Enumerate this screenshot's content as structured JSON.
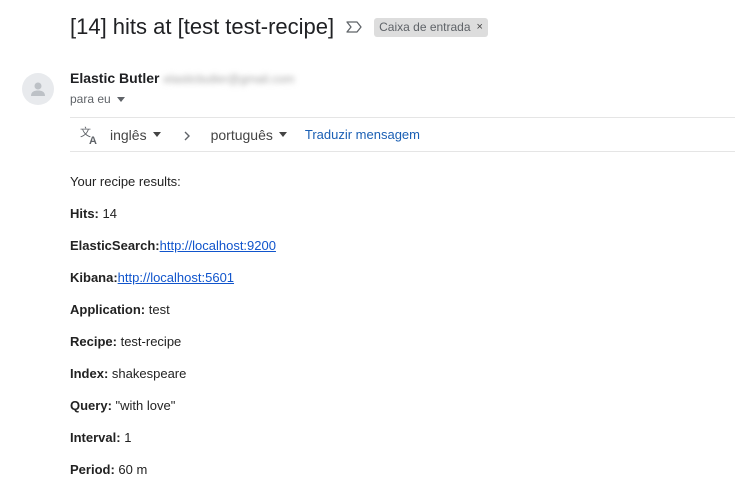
{
  "email": {
    "subject": "[14] hits at [test test-recipe]",
    "label": "Caixa de entrada",
    "label_close": "×",
    "sender_name": "Elastic Butler",
    "sender_email": "elasticbutler@gmail.com",
    "to": "para eu"
  },
  "translate": {
    "source_lang": "inglês",
    "target_lang": "português",
    "action": "Traduzir mensagem"
  },
  "body": {
    "intro": "Your recipe results:",
    "hits_label": "Hits:",
    "hits_value": "14",
    "es_label": "ElasticSearch:",
    "es_url": "http://localhost:9200",
    "kibana_label": "Kibana:",
    "kibana_url": "http://localhost:5601",
    "application_label": "Application:",
    "application_value": "test",
    "recipe_label": "Recipe:",
    "recipe_value": "test-recipe",
    "index_label": "Index:",
    "index_value": "shakespeare",
    "query_label": "Query:",
    "query_value": "\"with love\"",
    "interval_label": "Interval:",
    "interval_value": "1",
    "period_label": "Period:",
    "period_value": "60 m"
  },
  "icons": {
    "important": "important-marker-icon",
    "avatar": "person-icon",
    "translate": "translate-icon",
    "arrow": "chevron-right-icon"
  }
}
